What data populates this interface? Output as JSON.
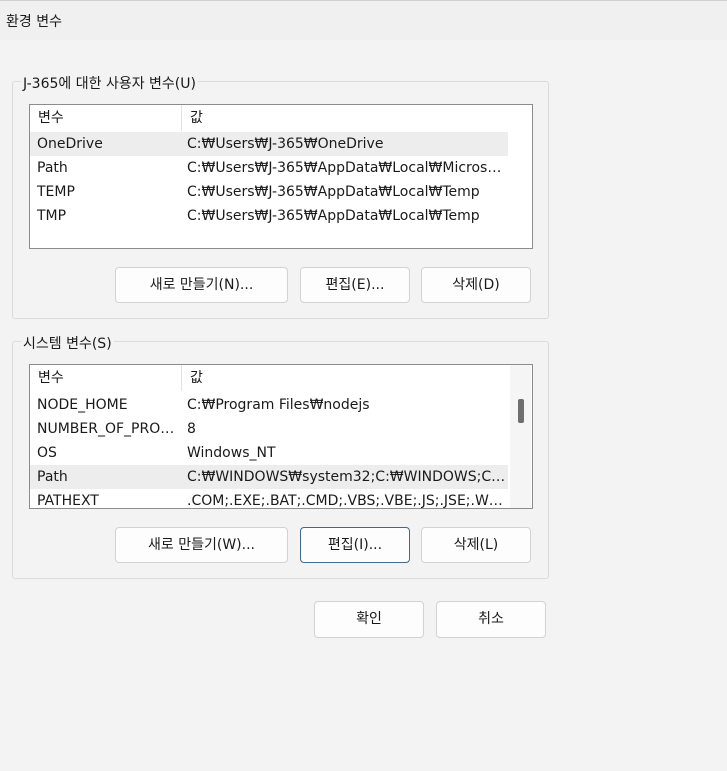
{
  "window": {
    "title": "환경 변수"
  },
  "user_vars": {
    "group_label": "J-365에 대한 사용자 변수(U)",
    "columns": [
      "변수",
      "값"
    ],
    "rows": [
      {
        "name": "OneDrive",
        "value": "C:₩Users₩J-365₩OneDrive"
      },
      {
        "name": "Path",
        "value": "C:₩Users₩J-365₩AppData₩Local₩Microsoft..."
      },
      {
        "name": "TEMP",
        "value": "C:₩Users₩J-365₩AppData₩Local₩Temp"
      },
      {
        "name": "TMP",
        "value": "C:₩Users₩J-365₩AppData₩Local₩Temp"
      }
    ],
    "buttons": {
      "new": "새로 만들기(N)...",
      "edit": "편집(E)...",
      "delete": "삭제(D)"
    }
  },
  "system_vars": {
    "group_label": "시스템 변수(S)",
    "columns": [
      "변수",
      "값"
    ],
    "rows": [
      {
        "name": "NODE_HOME",
        "value": "C:₩Program Files₩nodejs"
      },
      {
        "name": "NUMBER_OF_PROC...",
        "value": "8"
      },
      {
        "name": "OS",
        "value": "Windows_NT"
      },
      {
        "name": "Path",
        "value": "C:₩WINDOWS₩system32;C:₩WINDOWS;C:₩..."
      },
      {
        "name": "PATHEXT",
        "value": ".COM;.EXE;.BAT;.CMD;.VBS;.VBE;.JS;.JSE;.WSF;..."
      }
    ],
    "buttons": {
      "new": "새로 만들기(W)...",
      "edit": "편집(I)...",
      "delete": "삭제(L)"
    }
  },
  "dialog_buttons": {
    "ok": "확인",
    "cancel": "취소"
  }
}
